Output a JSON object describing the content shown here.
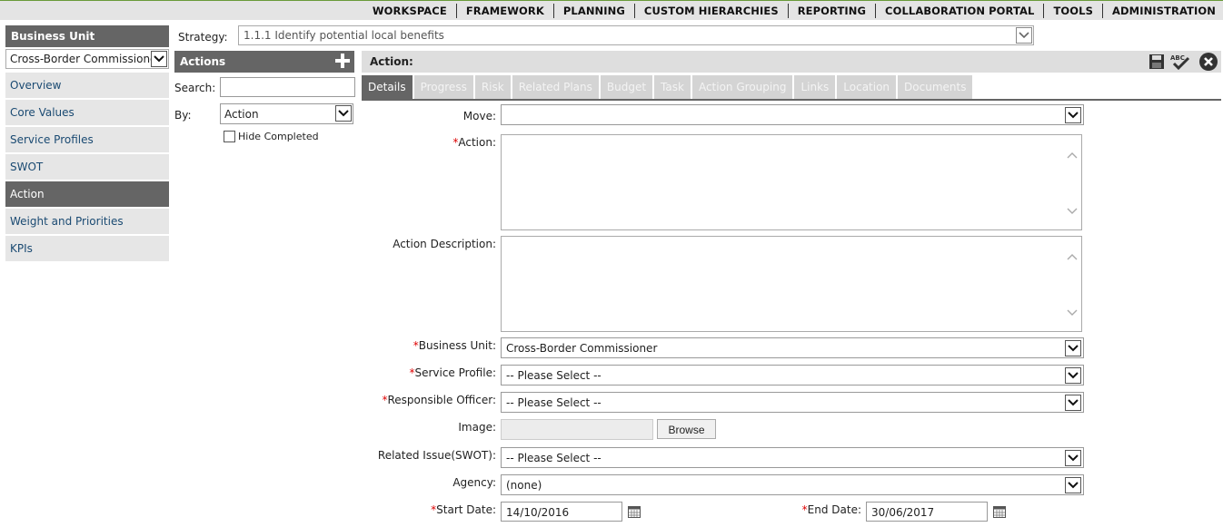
{
  "topnav": [
    "WORKSPACE",
    "FRAMEWORK",
    "PLANNING",
    "CUSTOM HIERARCHIES",
    "REPORTING",
    "COLLABORATION PORTAL",
    "TOOLS",
    "ADMINISTRATION"
  ],
  "business_unit": {
    "header": "Business Unit",
    "selected": "Cross-Border Commissioner"
  },
  "sidebar": {
    "items": [
      {
        "label": "Overview"
      },
      {
        "label": "Core Values"
      },
      {
        "label": "Service Profiles"
      },
      {
        "label": "SWOT"
      },
      {
        "label": "Action"
      },
      {
        "label": "Weight and Priorities"
      },
      {
        "label": "KPIs"
      }
    ],
    "active": "Action"
  },
  "strategy": {
    "label": "Strategy:",
    "value": "1.1.1 Identify potential local benefits"
  },
  "actions_panel": {
    "header": "Actions",
    "search_label": "Search:",
    "search_value": "",
    "by_label": "By:",
    "by_value": "Action",
    "hide_completed": "Hide Completed"
  },
  "action_panel": {
    "header": "Action:",
    "icons": [
      "save-icon",
      "spellcheck-icon",
      "close-icon"
    ]
  },
  "tabs": [
    "Details",
    "Progress",
    "Risk",
    "Related Plans",
    "Budget",
    "Task",
    "Action Grouping",
    "Links",
    "Location",
    "Documents"
  ],
  "active_tab": "Details",
  "form": {
    "move_label": "Move:",
    "move_value": "",
    "action_label": "Action:",
    "action_value": "",
    "description_label": "Action Description:",
    "description_value": "",
    "business_unit_label": "Business Unit:",
    "business_unit_value": "Cross-Border Commissioner",
    "service_profile_label": "Service Profile:",
    "service_profile_value": "-- Please Select --",
    "responsible_officer_label": "Responsible Officer:",
    "responsible_officer_value": "-- Please Select --",
    "image_label": "Image:",
    "browse_label": "Browse",
    "related_issue_label": "Related Issue(SWOT):",
    "related_issue_value": "-- Please Select --",
    "agency_label": "Agency:",
    "agency_value": "(none)",
    "start_date_label": "Start Date:",
    "start_date_value": "14/10/2016",
    "end_date_label": "End Date:",
    "end_date_value": "30/06/2017",
    "required_marker": "*"
  },
  "colors": {
    "header_dark": "#656565",
    "sidebar_bg": "#e6e6e6",
    "link_blue": "#1a4a72",
    "required_red": "#dd0000"
  }
}
